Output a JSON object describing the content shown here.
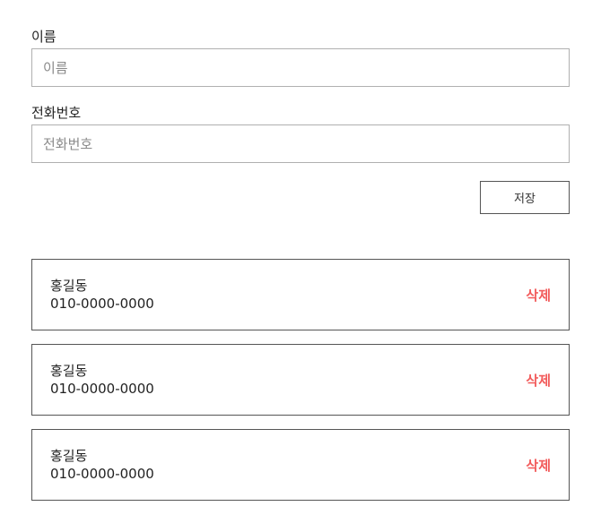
{
  "form": {
    "name": {
      "label": "이름",
      "placeholder": "이름",
      "value": ""
    },
    "phone": {
      "label": "전화번호",
      "placeholder": "전화번호",
      "value": ""
    },
    "save_label": "저장"
  },
  "contacts": [
    {
      "name": "홍길동",
      "phone": "010-0000-0000",
      "delete_label": "삭제"
    },
    {
      "name": "홍길동",
      "phone": "010-0000-0000",
      "delete_label": "삭제"
    },
    {
      "name": "홍길동",
      "phone": "010-0000-0000",
      "delete_label": "삭제"
    }
  ],
  "colors": {
    "delete": "#f25b5b",
    "border": "#555555",
    "input_border": "#b0b0b0"
  }
}
